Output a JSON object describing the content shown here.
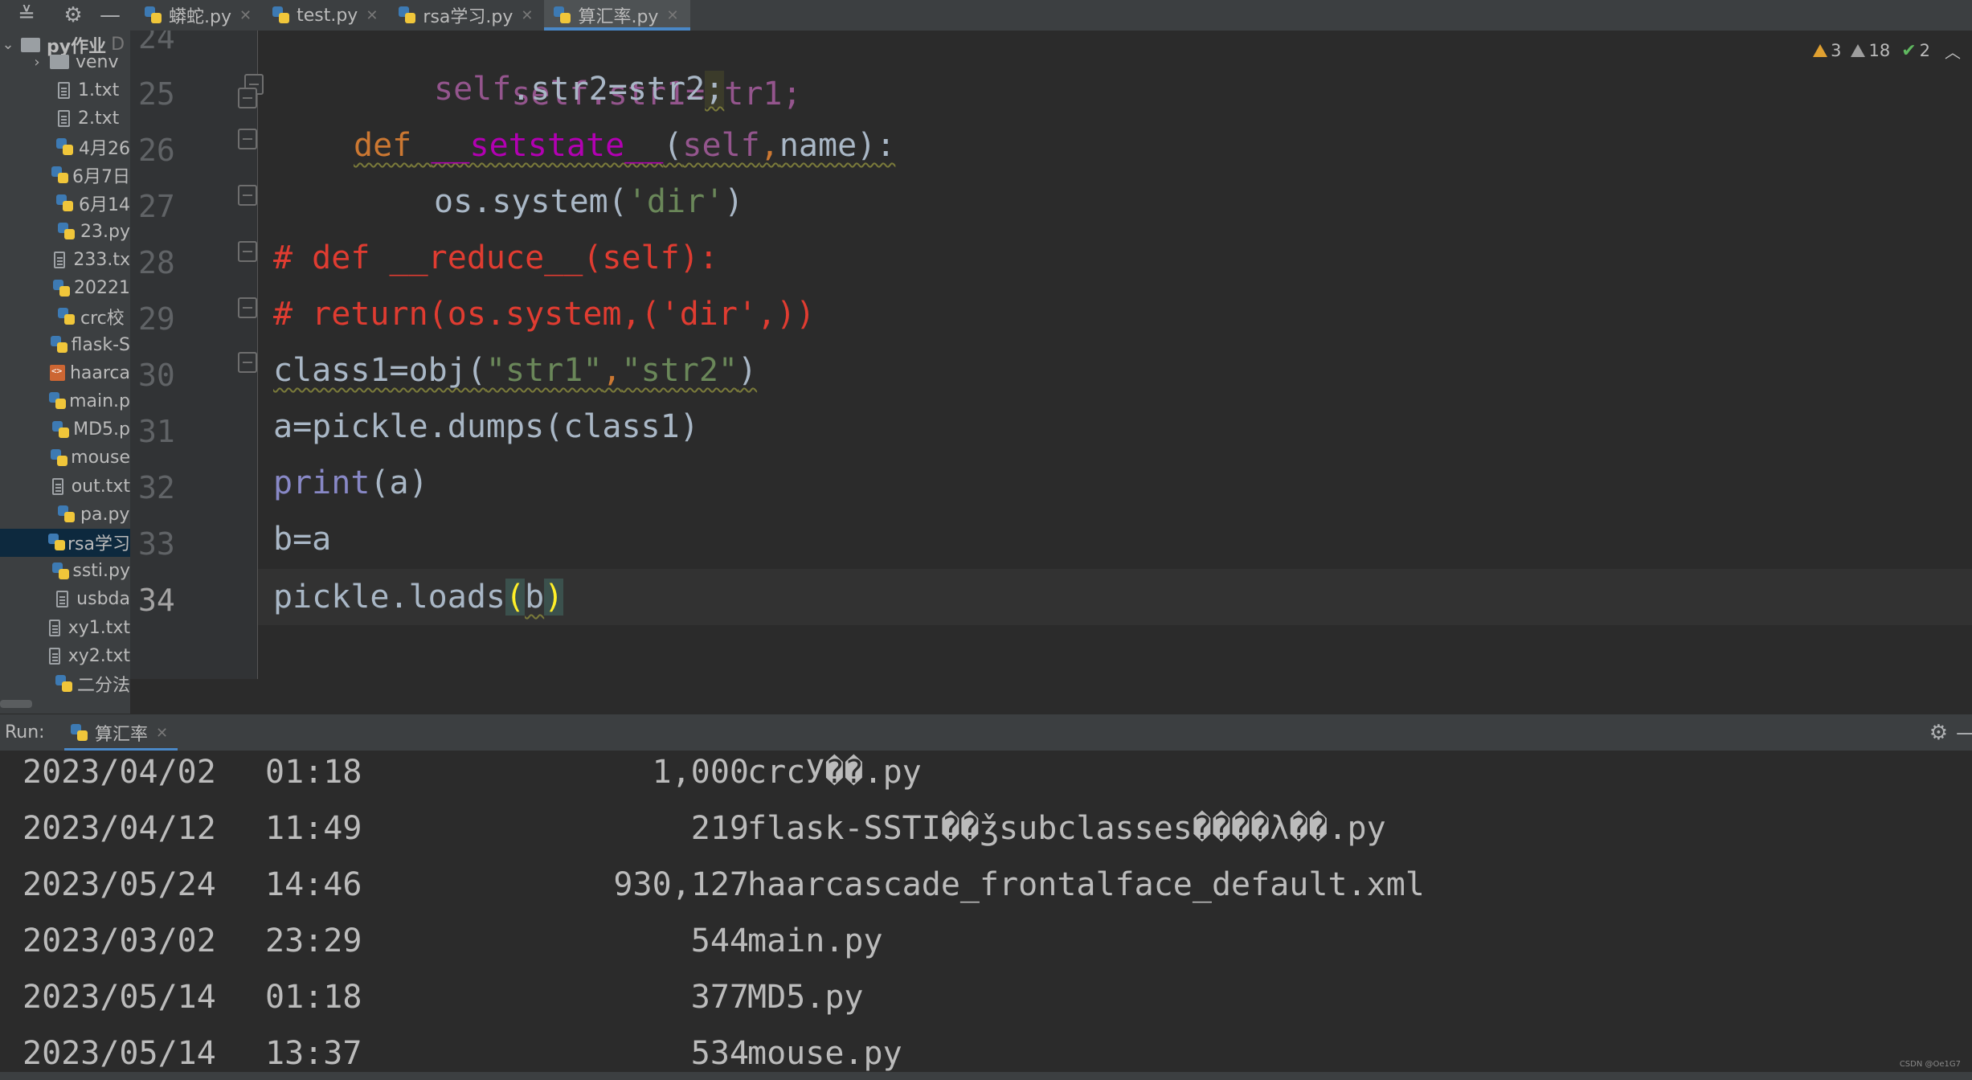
{
  "tabs": [
    {
      "label": "蟒蛇.py",
      "active": false
    },
    {
      "label": "test.py",
      "active": false
    },
    {
      "label": "rsa学习.py",
      "active": false
    },
    {
      "label": "算汇率.py",
      "active": true
    }
  ],
  "project": {
    "root": "py作业",
    "items": [
      {
        "label": "venv",
        "type": "folder"
      },
      {
        "label": "1.txt",
        "type": "txt"
      },
      {
        "label": "2.txt",
        "type": "txt"
      },
      {
        "label": "4月26",
        "type": "py"
      },
      {
        "label": "6月7日",
        "type": "py"
      },
      {
        "label": "6月14",
        "type": "py"
      },
      {
        "label": "23.py",
        "type": "py"
      },
      {
        "label": "233.tx",
        "type": "txt"
      },
      {
        "label": "20221",
        "type": "py"
      },
      {
        "label": "crc校",
        "type": "py"
      },
      {
        "label": "flask-S",
        "type": "py"
      },
      {
        "label": "haarca",
        "type": "xml"
      },
      {
        "label": "main.p",
        "type": "py"
      },
      {
        "label": "MD5.p",
        "type": "py"
      },
      {
        "label": "mouse",
        "type": "py"
      },
      {
        "label": "out.txt",
        "type": "txt"
      },
      {
        "label": "pa.py",
        "type": "py"
      },
      {
        "label": "rsa学习",
        "type": "py",
        "selected": true
      },
      {
        "label": "ssti.py",
        "type": "py"
      },
      {
        "label": "usbda",
        "type": "txt"
      },
      {
        "label": "xy1.txt",
        "type": "txt"
      },
      {
        "label": "xy2.txt",
        "type": "txt"
      },
      {
        "label": "二分法",
        "type": "py"
      }
    ]
  },
  "inspections": {
    "warnings": "3",
    "weak_warnings": "18",
    "ok": "2"
  },
  "editor": {
    "line_numbers": [
      "24",
      "25",
      "26",
      "27",
      "28",
      "29",
      "30",
      "31",
      "32",
      "33",
      "34"
    ],
    "line24": {
      "code": "self.str1=str1;"
    },
    "line25": {
      "self": "self",
      "rest": ".str2=str2",
      "semi": ";"
    },
    "line26": {
      "kw": "def",
      "name": "__setstate__",
      "open": "(",
      "self": "self",
      "comma": ",",
      "args": "name):"
    },
    "line27": {
      "code": "os.system(",
      "str": "'dir'",
      "close": ")"
    },
    "line28": {
      "comment": "# def __reduce__(self):"
    },
    "line29": {
      "comment": "# return(os.system,('dir',))"
    },
    "line30": {
      "pre": "class1=obj(",
      "s1": "\"str1\"",
      "comma": ",",
      "s2": "\"str2\"",
      "close": ")"
    },
    "line31": {
      "code": "a=pickle.dumps(class1)"
    },
    "line32": {
      "builtin": "print",
      "rest": "(a)"
    },
    "line33": {
      "code": "b=a"
    },
    "line34": {
      "pre": "pickle.loads",
      "open": "(",
      "arg": "b",
      "close": ")"
    }
  },
  "run": {
    "label": "Run:",
    "tab": "算汇率",
    "output": [
      {
        "date": "2023/04/02",
        "time": "01:18",
        "size": "1,000",
        "name": "crcУ��.py"
      },
      {
        "date": "2023/04/12",
        "time": "11:49",
        "size": "219",
        "name": "flask-SSTI��ǯsubclasses����λ��.py"
      },
      {
        "date": "2023/05/24",
        "time": "14:46",
        "size": "930,127",
        "name": "haarcascade_frontalface_default.xml"
      },
      {
        "date": "2023/03/02",
        "time": "23:29",
        "size": "544",
        "name": "main.py"
      },
      {
        "date": "2023/05/14",
        "time": "01:18",
        "size": "377",
        "name": "MD5.py"
      },
      {
        "date": "2023/05/14",
        "time": "13:37",
        "size": "534",
        "name": "mouse.py"
      }
    ]
  },
  "watermark": "CSDN @Oe1G7"
}
